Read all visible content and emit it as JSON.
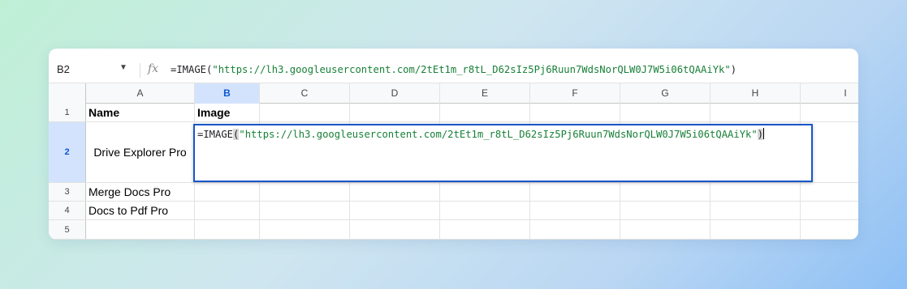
{
  "formula_bar": {
    "cell_ref": "B2",
    "fx_icon": "fx-icon",
    "formula_prefix": "=IMAGE(",
    "formula_string": "\"https://lh3.googleusercontent.com/2tEt1m_r8tL_D62sIz5Pj6Ruun7WdsNorQLW0J7W5i06tQAAiYk\"",
    "formula_suffix": ")"
  },
  "columns": [
    "A",
    "B",
    "C",
    "D",
    "E",
    "F",
    "G",
    "H",
    "I"
  ],
  "rows": [
    {
      "num": "1",
      "a": "Name",
      "b": "Image"
    },
    {
      "num": "2",
      "a": "Drive Explorer Pro",
      "b": ""
    },
    {
      "num": "3",
      "a": "Merge Docs Pro",
      "b": ""
    },
    {
      "num": "4",
      "a": "Docs to Pdf Pro",
      "b": ""
    },
    {
      "num": "5",
      "a": "",
      "b": ""
    }
  ],
  "editor": {
    "prefix": "=IMAGE",
    "open_paren": "(",
    "string": "\"https://lh3.googleusercontent.com/2tEt1m_r8tL_D62sIz5Pj6Ruun7WdsNorQLW0J7W5i06tQAAiYk\"",
    "close_paren": ")"
  },
  "colors": {
    "selection": "#1a56c9",
    "string": "#188038",
    "active_header": "#d3e3fd"
  }
}
